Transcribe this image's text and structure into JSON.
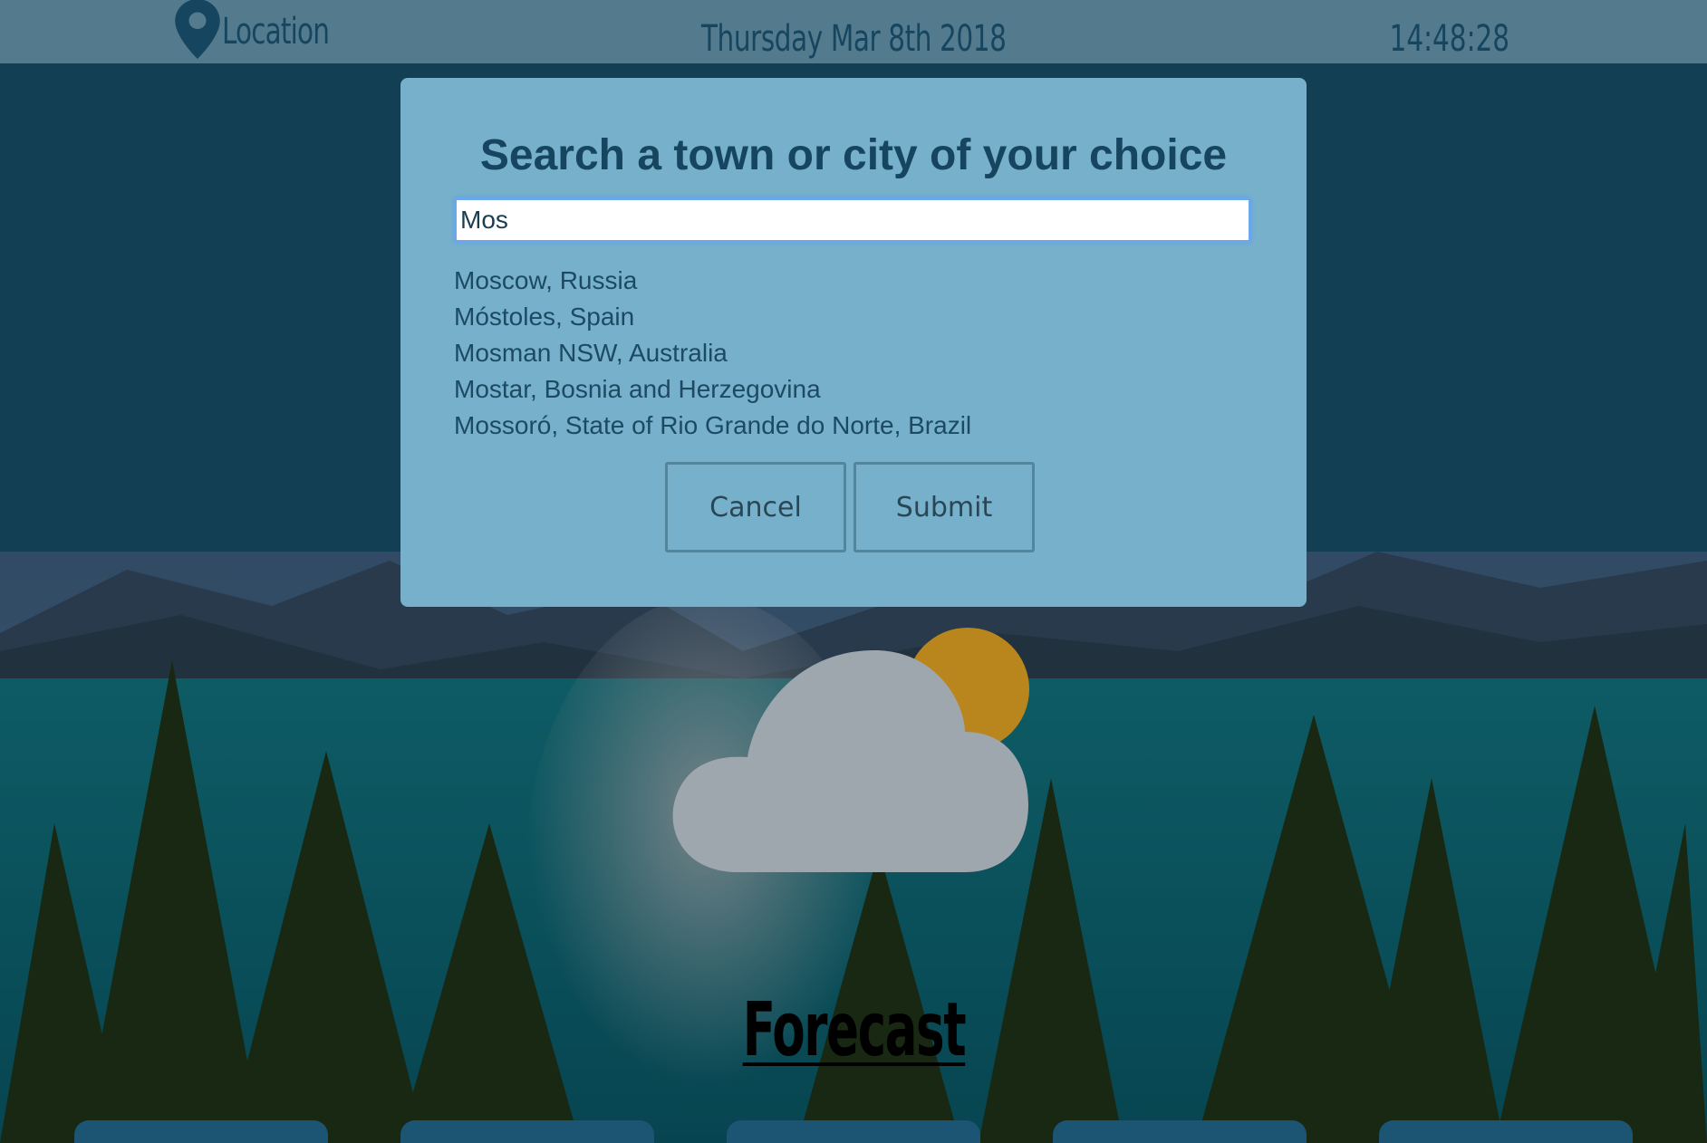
{
  "header": {
    "location_label": "Location",
    "date": "Thursday Mar 8th 2018",
    "time": "14:48:28"
  },
  "dialog": {
    "title": "Search a town or city of your choice",
    "search_value": "Mos",
    "suggestions": [
      "Moscow, Russia",
      "Móstoles, Spain",
      "Mosman NSW, Australia",
      "Mostar, Bosnia and Herzegovina",
      "Mossoró, State of Rio Grande do Norte, Brazil"
    ],
    "cancel_label": "Cancel",
    "submit_label": "Submit"
  },
  "weather": {
    "icon": "partly-cloudy-icon"
  },
  "forecast": {
    "heading": "Forecast"
  },
  "colors": {
    "header_bg": "#547a8e",
    "page_bg": "#133f55",
    "dialog_bg": "#77b0cb",
    "text_dark": "#16465f"
  }
}
